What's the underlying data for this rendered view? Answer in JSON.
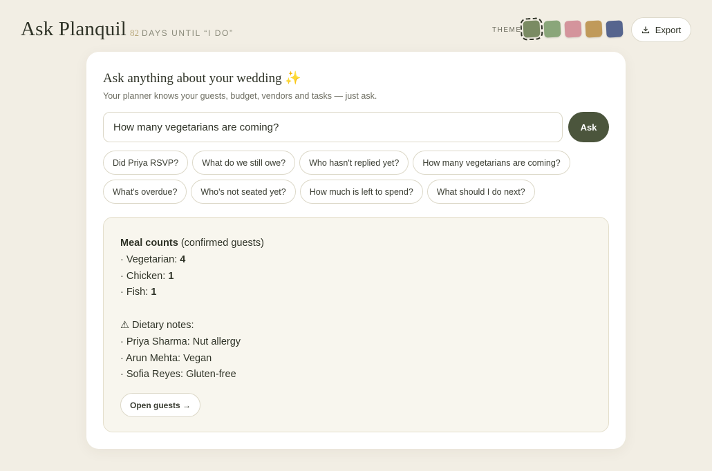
{
  "header": {
    "app_title": "Ask Planquil",
    "countdown_number": "82",
    "countdown_text": "DAYS UNTIL “I DO”",
    "theme_label": "THEME",
    "theme_swatches": [
      {
        "color": "#7a8b63",
        "selected": true
      },
      {
        "color": "#8aa67a",
        "selected": false
      },
      {
        "color": "#d4949c",
        "selected": false
      },
      {
        "color": "#c09a5a",
        "selected": false
      },
      {
        "color": "#56658e",
        "selected": false
      }
    ],
    "export_label": "Export"
  },
  "ask": {
    "title": "Ask anything about your wedding ✨",
    "subtitle": "Your planner knows your guests, budget, vendors and tasks — just ask.",
    "input_value": "How many vegetarians are coming?",
    "button_label": "Ask",
    "suggestions_row1": [
      "Did Priya RSVP?",
      "What do we still owe?",
      "Who hasn't replied yet?",
      "How many vegetarians are coming?"
    ],
    "suggestions_row2": [
      "What's overdue?",
      "Who's not seated yet?",
      "How much is left to spend?",
      "What should I do next?"
    ]
  },
  "answer": {
    "heading_bold": "Meal counts",
    "heading_rest": " (confirmed guests)",
    "meals": [
      {
        "prefix": "· Vegetarian: ",
        "count": "4"
      },
      {
        "prefix": "· Chicken: ",
        "count": "1"
      },
      {
        "prefix": "· Fish: ",
        "count": "1"
      }
    ],
    "dietary_heading": "⚠ Dietary notes:",
    "dietary_notes": [
      "· Priya Sharma: Nut allergy",
      "· Arun Mehta: Vegan",
      "· Sofia Reyes: Gluten-free"
    ],
    "link_label": "Open guests →"
  }
}
